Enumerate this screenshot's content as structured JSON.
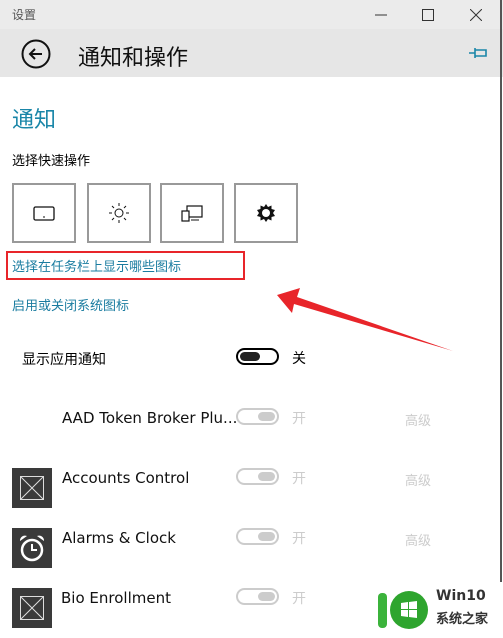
{
  "window": {
    "title": "设置",
    "controls": [
      "minimize-icon",
      "maximize-icon",
      "close-icon"
    ]
  },
  "header": {
    "title": "通知和操作",
    "back_icon": "back-arrow-icon",
    "pin_icon": "pin-icon"
  },
  "section": {
    "title": "通知",
    "quick_actions_label": "选择快速操作",
    "quick_actions": [
      {
        "icon": "tablet-mode-icon"
      },
      {
        "icon": "brightness-icon"
      },
      {
        "icon": "project-icon"
      },
      {
        "icon": "settings-gear-icon"
      }
    ],
    "link_taskbar_icons": "选择在任务栏上显示哪些图标",
    "link_system_icons": "启用或关闭系统图标"
  },
  "show_notifications": {
    "label": "显示应用通知",
    "state": "关",
    "on": false
  },
  "apps": [
    {
      "name": "AAD Token Broker Plu...",
      "state": "开",
      "advanced": "高级",
      "icon": "none"
    },
    {
      "name": "Accounts Control",
      "state": "开",
      "advanced": "高级",
      "icon": "placeholder-icon"
    },
    {
      "name": "Alarms & Clock",
      "state": "开",
      "advanced": "高级",
      "icon": "alarm-clock-icon"
    },
    {
      "name": "Bio Enrollment",
      "state": "开",
      "advanced": "",
      "icon": "placeholder-icon"
    }
  ],
  "annotation": {
    "color": "#e8252a"
  },
  "watermark": {
    "line1": "Win10",
    "line2": "系统之家"
  },
  "colors": {
    "accent": "#1a86a8",
    "link": "#1a7ca0"
  }
}
